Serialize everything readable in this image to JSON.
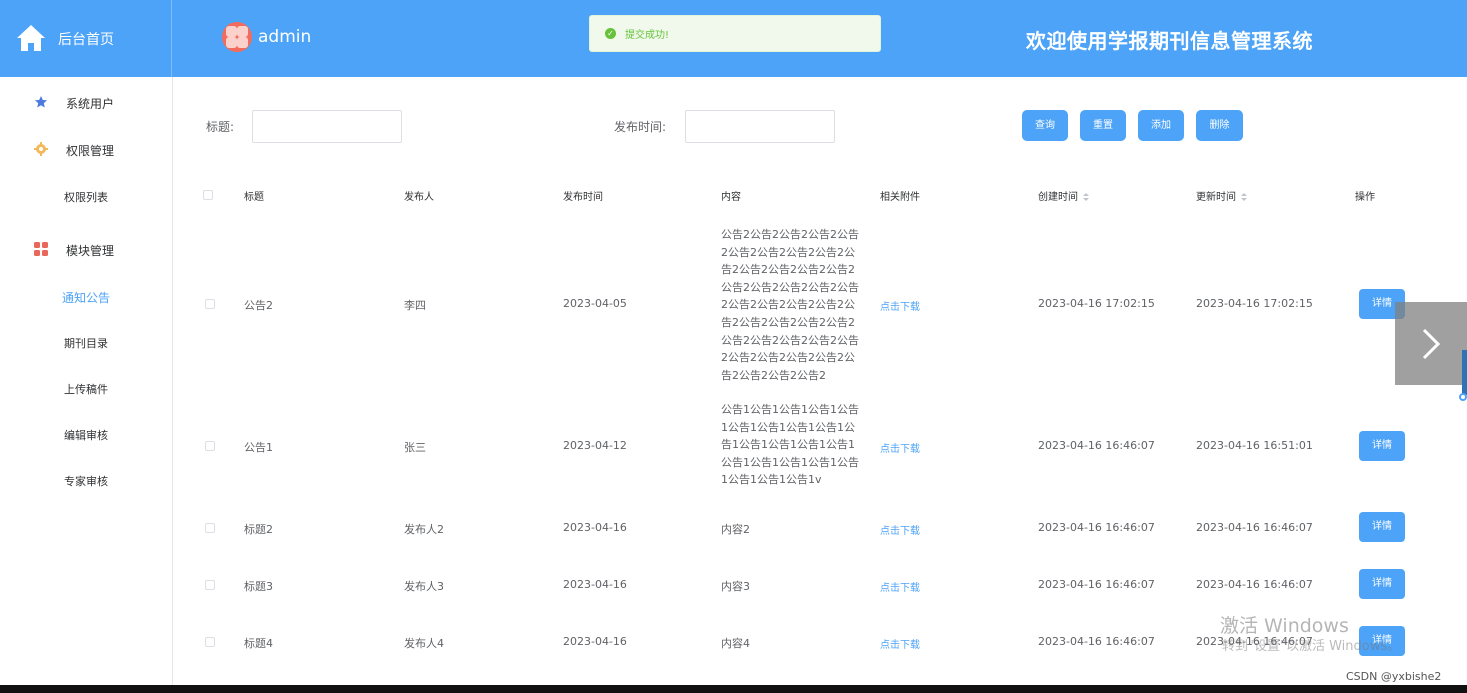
{
  "header": {
    "home_label": "后台首页",
    "username": "admin",
    "app_title": "欢迎使用学报期刊信息管理系统",
    "accent_color": "#4da3f7"
  },
  "toast": {
    "message": "提交成功!",
    "type": "success"
  },
  "sidebar": {
    "menus": [
      {
        "label": "系统用户",
        "icon": "star-icon"
      },
      {
        "label": "权限管理",
        "icon": "gear-icon"
      },
      {
        "label": "模块管理",
        "icon": "grid-icon"
      }
    ],
    "sub_items": [
      "权限列表",
      "通知公告",
      "期刊目录",
      "上传稿件",
      "编辑审核",
      "专家审核"
    ],
    "active_item": "通知公告"
  },
  "search": {
    "title_label": "标题:",
    "title_value": "",
    "time_label": "发布时间:",
    "time_value": "",
    "buttons": {
      "query": "查询",
      "reset": "重置",
      "add": "添加",
      "delete": "删除"
    }
  },
  "table": {
    "columns": [
      "标题",
      "发布人",
      "发布时间",
      "内容",
      "相关附件",
      "创建时间",
      "更新时间",
      "操作"
    ],
    "rows": [
      {
        "title": "公告2",
        "publisher": "李四",
        "publish_time": "2023-04-05",
        "content": "公告2公告2公告2公告2公告2公告2公告2公告2公告2公告2公告2公告2公告2公告2公告2公告2公告2公告2公告2公告2公告2公告2公告2公告2公告2公告2公告2公告2公告2公告2公告2公告2公告2公告2公告2公告2公告2公告2公告2公告2公告2",
        "attachment": "点击下载",
        "created": "2023-04-16 17:02:15",
        "updated": "2023-04-16 17:02:15",
        "action": "详情"
      },
      {
        "title": "公告1",
        "publisher": "张三",
        "publish_time": "2023-04-12",
        "content": "公告1公告1公告1公告1公告1公告1公告1公告1公告1公告1公告1公告1公告1公告1公告1公告1公告1公告1公告1公告1公告1公告1v",
        "attachment": "点击下载",
        "created": "2023-04-16 16:46:07",
        "updated": "2023-04-16 16:51:01",
        "action": "详情"
      },
      {
        "title": "标题2",
        "publisher": "发布人2",
        "publish_time": "2023-04-16",
        "content": "内容2",
        "attachment": "点击下载",
        "created": "2023-04-16 16:46:07",
        "updated": "2023-04-16 16:46:07",
        "action": "详情"
      },
      {
        "title": "标题3",
        "publisher": "发布人3",
        "publish_time": "2023-04-16",
        "content": "内容3",
        "attachment": "点击下载",
        "created": "2023-04-16 16:46:07",
        "updated": "2023-04-16 16:46:07",
        "action": "详情"
      },
      {
        "title": "标题4",
        "publisher": "发布人4",
        "publish_time": "2023-04-16",
        "content": "内容4",
        "attachment": "点击下载",
        "created": "2023-04-16 16:46:07",
        "updated": "2023-04-16 16:46:07",
        "action": "详情"
      }
    ]
  },
  "watermark": {
    "line1": "激活 Windows",
    "line2": "转到\"设置\"以激活 Windows。"
  },
  "credit": "CSDN @yxbishe2"
}
